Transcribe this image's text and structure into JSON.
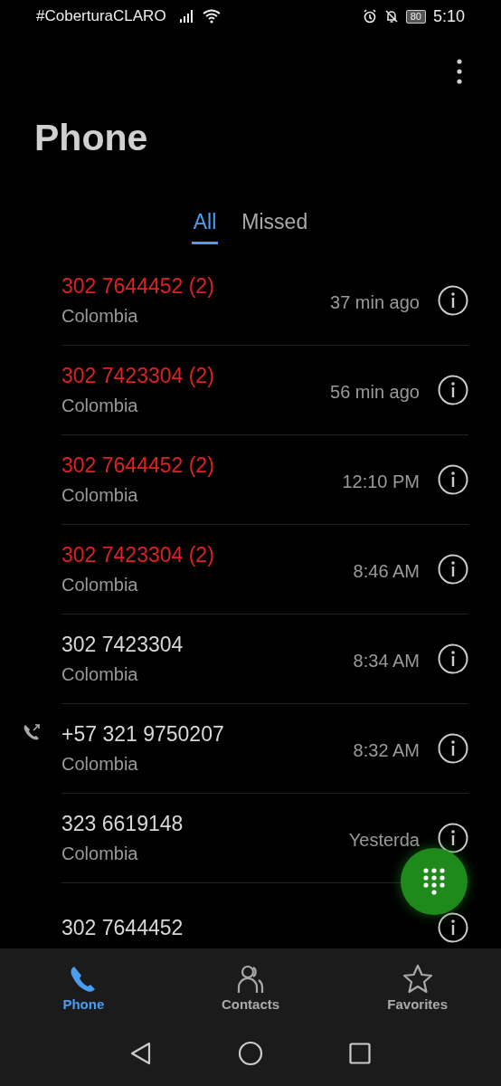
{
  "status_bar": {
    "carrier": "#CoberturaCLARO",
    "battery": "80",
    "time": "5:10"
  },
  "title": "Phone",
  "tabs": [
    {
      "label": "All",
      "selected": true
    },
    {
      "label": "Missed",
      "selected": false
    }
  ],
  "calls": [
    {
      "number": "302 7644452 (2)",
      "location": "Colombia",
      "time": "37 min ago",
      "missed": true,
      "outgoing": false
    },
    {
      "number": "302 7423304 (2)",
      "location": "Colombia",
      "time": "56 min ago",
      "missed": true,
      "outgoing": false
    },
    {
      "number": "302 7644452 (2)",
      "location": "Colombia",
      "time": "12:10 PM",
      "missed": true,
      "outgoing": false
    },
    {
      "number": "302 7423304 (2)",
      "location": "Colombia",
      "time": "8:46 AM",
      "missed": true,
      "outgoing": false
    },
    {
      "number": "302 7423304",
      "location": "Colombia",
      "time": "8:34 AM",
      "missed": false,
      "outgoing": false
    },
    {
      "number": "+57 321 9750207",
      "location": "Colombia",
      "time": "8:32 AM",
      "missed": false,
      "outgoing": true
    },
    {
      "number": "323 6619148",
      "location": "Colombia",
      "time": "Yesterda",
      "missed": false,
      "outgoing": false
    },
    {
      "number": "302 7644452",
      "missed": false,
      "outgoing": false
    }
  ],
  "bottom_nav": [
    {
      "label": "Phone",
      "kind": "phone",
      "selected": true
    },
    {
      "label": "Contacts",
      "kind": "contacts",
      "selected": false
    },
    {
      "label": "Favorites",
      "kind": "star",
      "selected": false
    }
  ]
}
